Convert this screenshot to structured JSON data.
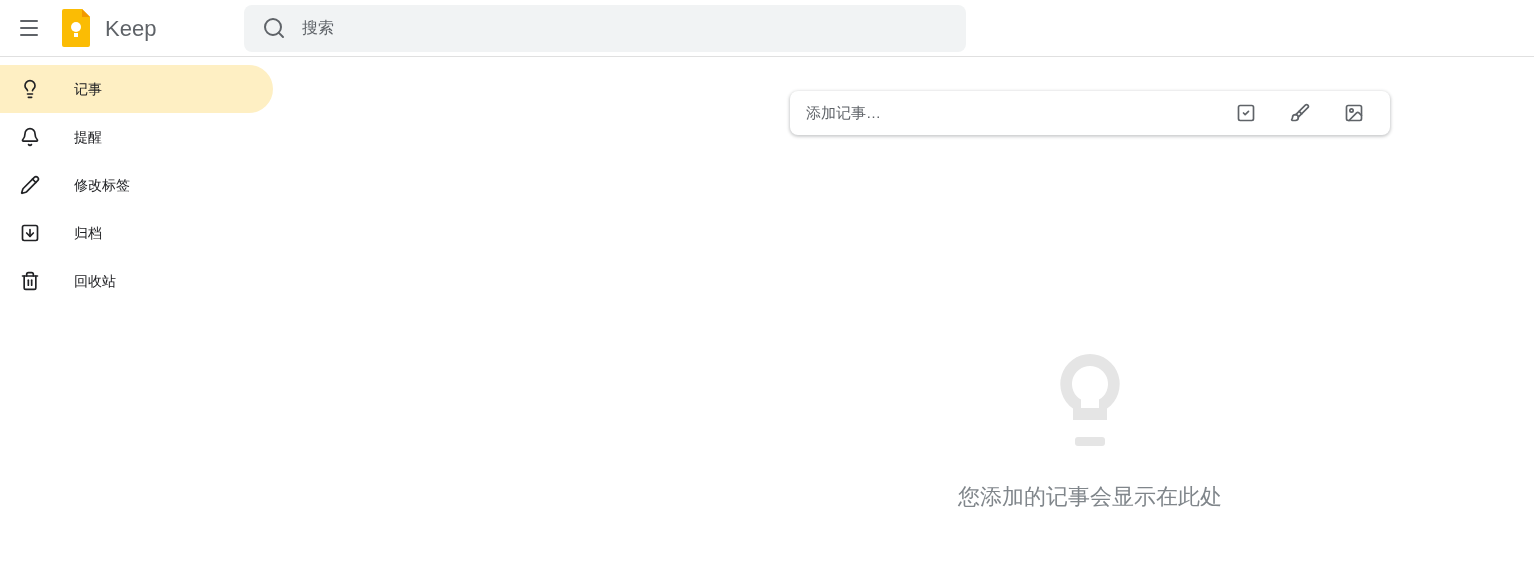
{
  "header": {
    "app_name": "Keep",
    "search": {
      "placeholder": "搜索"
    }
  },
  "sidebar": {
    "items": [
      {
        "label": "记事",
        "kind": "bulb",
        "selected": true
      },
      {
        "label": "提醒",
        "kind": "bell",
        "selected": false
      },
      {
        "label": "修改标签",
        "kind": "pencil",
        "selected": false
      },
      {
        "label": "归档",
        "kind": "archive",
        "selected": false
      },
      {
        "label": "回收站",
        "kind": "trash",
        "selected": false
      }
    ]
  },
  "note_input": {
    "placeholder": "添加记事…"
  },
  "empty_state": {
    "message": "您添加的记事会显示在此处"
  }
}
